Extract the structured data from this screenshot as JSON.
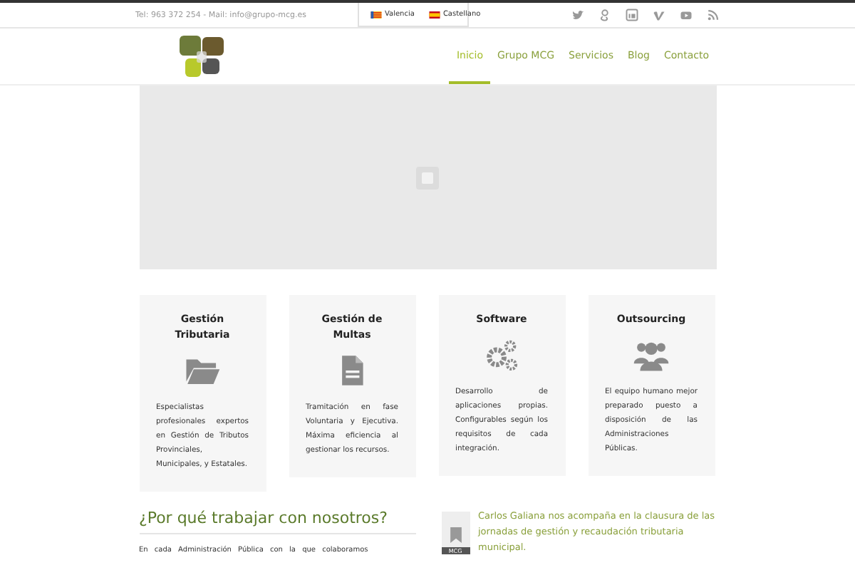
{
  "topbar": {
    "contact": "Tel: 963 372 254 - Mail: info@grupo-mcg.es",
    "languages": [
      {
        "label": "Valencia"
      },
      {
        "label": "Castellano"
      }
    ]
  },
  "nav": {
    "items": [
      {
        "label": "Inicio",
        "selected": true
      },
      {
        "label": "Grupo MCG",
        "selected": false
      },
      {
        "label": "Servicios",
        "selected": false
      },
      {
        "label": "Blog",
        "selected": false
      },
      {
        "label": "Contacto",
        "selected": false
      }
    ]
  },
  "services": [
    {
      "title": "Gestión Tributaria",
      "text": "Especialistas profesionales expertos en Gestión de Tributos Provinciales, Municipales, y Estatales."
    },
    {
      "title": "Gestión de Multas",
      "text": "Tramitación en fase Voluntaria y Ejecutiva. Máxima eficiencia al gestionar los recursos."
    },
    {
      "title": "Software",
      "text": "Desarrollo de aplicaciones propias. Configurables según los requisitos de cada integración."
    },
    {
      "title": "Outsourcing",
      "text": "El equipo humano mejor preparado puesto a disposición de las Administraciones Públicas."
    }
  ],
  "why": {
    "heading": "¿Por qué trabajar con nosotros?",
    "text": "En cada Administración Pública con la que colaboramos"
  },
  "news": {
    "badge": "MCG",
    "title": "Carlos Galiana nos acompaña en la clausura de las jornadas de gestión y recaudación tributaria municipal."
  }
}
